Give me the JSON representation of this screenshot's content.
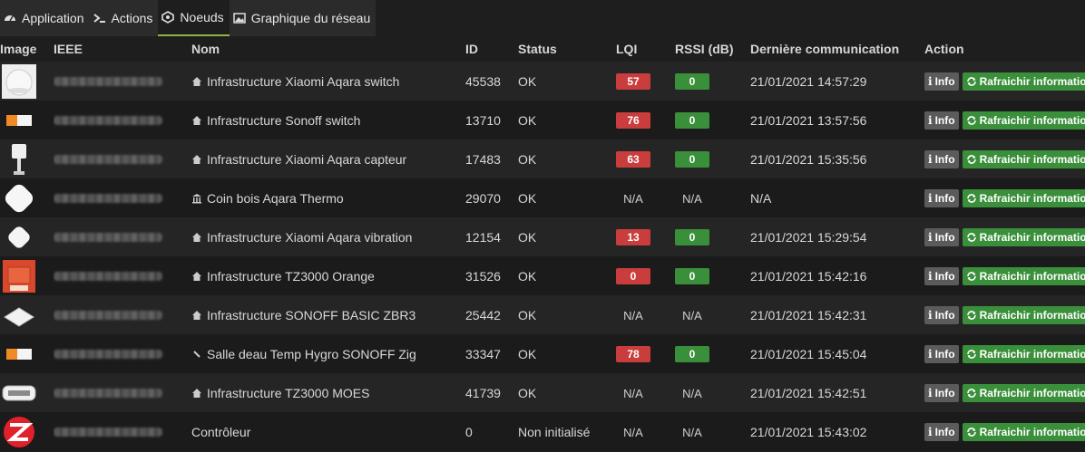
{
  "tabs": [
    {
      "label": "Application",
      "icon": "dashboard-icon"
    },
    {
      "label": "Actions",
      "icon": "terminal-icon"
    },
    {
      "label": "Noeuds",
      "icon": "nodes-icon"
    },
    {
      "label": "Graphique du réseau",
      "icon": "image-icon"
    }
  ],
  "table": {
    "headers": [
      "Image",
      "IEEE",
      "Nom",
      "ID",
      "Status",
      "LQI",
      "RSSI (dB)",
      "Dernière communication",
      "Action"
    ],
    "rows": [
      {
        "icon": "home",
        "image": "aqara-switch",
        "nom": "Infrastructure Xiaomi Aqara switch",
        "id": "45538",
        "status": "OK",
        "lqi": "57",
        "lqi_color": "red",
        "rssi": "0",
        "rssi_color": "green",
        "last": "21/01/2021 14:57:29"
      },
      {
        "icon": "home",
        "image": "sonoff-switch",
        "nom": "Infrastructure Sonoff switch",
        "id": "13710",
        "status": "OK",
        "lqi": "76",
        "lqi_color": "red",
        "rssi": "0",
        "rssi_color": "green",
        "last": "21/01/2021 13:57:56"
      },
      {
        "icon": "home",
        "image": "aqara-sensor",
        "nom": "Infrastructure Xiaomi Aqara capteur",
        "id": "17483",
        "status": "OK",
        "lqi": "63",
        "lqi_color": "red",
        "rssi": "0",
        "rssi_color": "green",
        "last": "21/01/2021 15:35:56"
      },
      {
        "icon": "bank",
        "image": "aqara-thermo",
        "nom": "Coin bois Aqara Thermo",
        "id": "29070",
        "status": "OK",
        "lqi": "N/A",
        "lqi_color": "",
        "rssi": "N/A",
        "rssi_color": "",
        "last": "N/A"
      },
      {
        "icon": "home",
        "image": "aqara-vibration",
        "nom": "Infrastructure Xiaomi Aqara vibration",
        "id": "12154",
        "status": "OK",
        "lqi": "13",
        "lqi_color": "red",
        "rssi": "0",
        "rssi_color": "green",
        "last": "21/01/2021 15:29:54"
      },
      {
        "icon": "home",
        "image": "tz3000-orange",
        "nom": "Infrastructure TZ3000 Orange",
        "id": "31526",
        "status": "OK",
        "lqi": "0",
        "lqi_color": "red",
        "rssi": "0",
        "rssi_color": "green",
        "last": "21/01/2021 15:42:16"
      },
      {
        "icon": "home",
        "image": "sonoff-basic",
        "nom": "Infrastructure SONOFF BASIC ZBR3",
        "id": "25442",
        "status": "OK",
        "lqi": "N/A",
        "lqi_color": "",
        "rssi": "N/A",
        "rssi_color": "",
        "last": "21/01/2021 15:42:31"
      },
      {
        "icon": "thermo",
        "image": "sonoff-switch",
        "nom": "Salle deau Temp Hygro SONOFF Zig",
        "id": "33347",
        "status": "OK",
        "lqi": "78",
        "lqi_color": "red",
        "rssi": "0",
        "rssi_color": "green",
        "last": "21/01/2021 15:45:04"
      },
      {
        "icon": "home",
        "image": "moes",
        "nom": "Infrastructure TZ3000 MOES",
        "id": "41739",
        "status": "OK",
        "lqi": "N/A",
        "lqi_color": "",
        "rssi": "N/A",
        "rssi_color": "",
        "last": "21/01/2021 15:42:51"
      },
      {
        "icon": "",
        "image": "zigbee",
        "nom": "Contrôleur",
        "id": "0",
        "status": "Non initialisé",
        "lqi": "N/A",
        "lqi_color": "",
        "rssi": "N/A",
        "rssi_color": "",
        "last": "21/01/2021 15:43:02"
      }
    ]
  },
  "buttons": {
    "info": "Info",
    "refresh": "Rafraichir informations"
  },
  "colors": {
    "accent": "#8fb34a",
    "red_badge": "#c93d3d",
    "green_badge": "#3a8f3a",
    "info_btn": "#5b5b5b"
  }
}
